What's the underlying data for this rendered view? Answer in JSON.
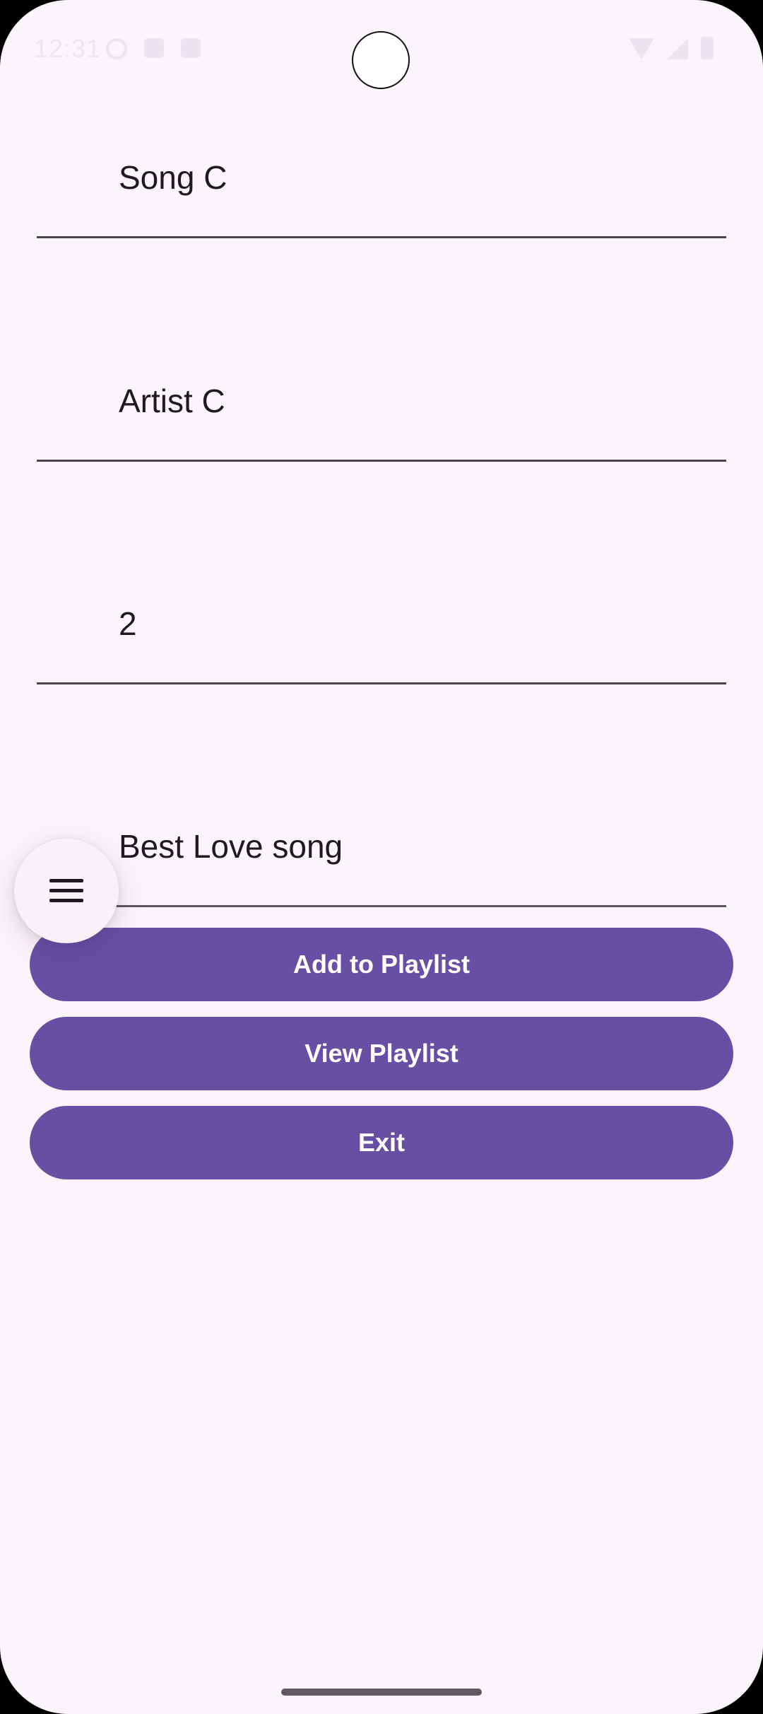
{
  "status_bar": {
    "time": "12:31"
  },
  "form": {
    "fields": [
      {
        "value": "Song C"
      },
      {
        "value": "Artist C"
      },
      {
        "value": "2"
      },
      {
        "value": "Best Love song"
      }
    ]
  },
  "actions": {
    "add_label": "Add to Playlist",
    "view_label": "View Playlist",
    "exit_label": "Exit"
  },
  "fab": {
    "icon": "menu-icon"
  },
  "colors": {
    "background": "#fcf4fb",
    "primary": "#6750a4",
    "text": "#1d1b20"
  }
}
